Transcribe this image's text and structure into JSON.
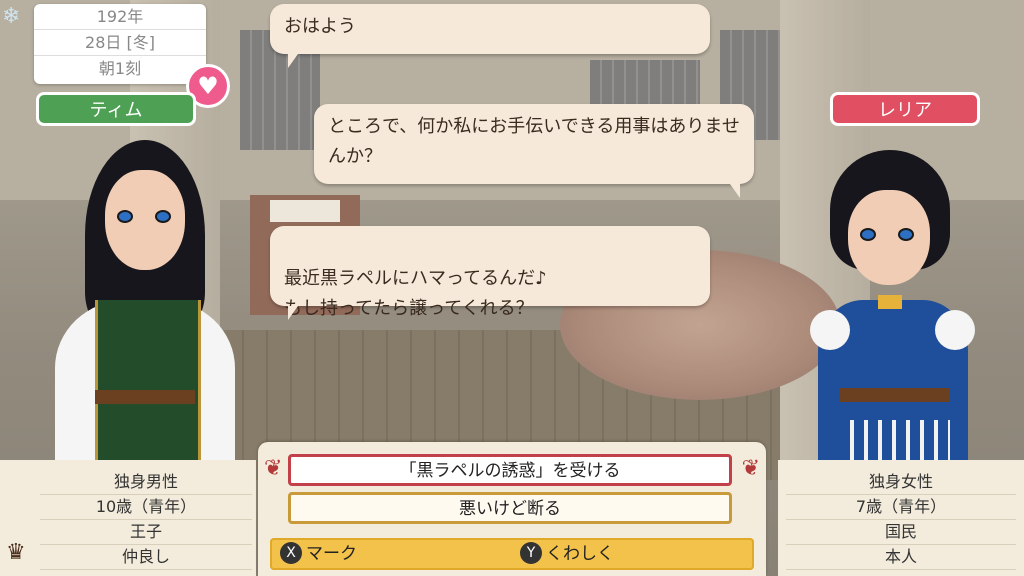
{
  "date": {
    "year": "192年",
    "day": "28日 [冬]",
    "time": "朝1刻"
  },
  "characters": {
    "left": {
      "name": "ティム",
      "status": "独身男性",
      "age": "10歳（青年）",
      "role": "王子",
      "relation": "仲良し"
    },
    "right": {
      "name": "レリア",
      "status": "独身女性",
      "age": "7歳（青年）",
      "role": "国民",
      "relation": "本人"
    }
  },
  "dialogue": [
    "おはよう",
    "ところで、何か私にお手伝いできる用事はありませんか？",
    "最近黒ラペルにハマってるんだ♪\nもし持ってたら譲ってくれる？"
  ],
  "choices": [
    "「黒ラペルの誘惑」を受ける",
    "悪いけど断る"
  ],
  "actions": {
    "mark": {
      "button": "X",
      "label": "マーク"
    },
    "detail": {
      "button": "Y",
      "label": "くわしく"
    }
  },
  "icons": {
    "heart": "heart-icon",
    "crown": "crown-icon",
    "snowflake": "snowflake-icon"
  },
  "colors": {
    "accent_green": "#4ea154",
    "accent_red": "#e04f62",
    "choice_selected": "#c2404a",
    "action_bar": "#f2c24a"
  }
}
